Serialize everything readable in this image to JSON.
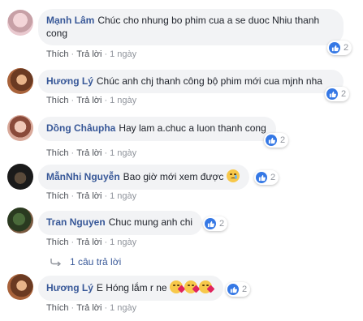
{
  "actions": {
    "like": "Thích",
    "reply": "Trả lời",
    "separator": "·"
  },
  "comments": [
    {
      "author": "Mạnh Lâm",
      "text": "Chúc cho nhung bo phim cua a se duoc Nhiu thanh cong",
      "time": "1 ngày",
      "reactions": "2"
    },
    {
      "author": "Hương Lý",
      "text": "Chúc anh chj thanh công bộ phim mới cua mjnh nha",
      "time": "1 ngày",
      "reactions": "2"
    },
    {
      "author": "Dồng Châupha",
      "text": "Hay lam a.chuc a luon thanh cong",
      "time": "1 ngày",
      "reactions": "2"
    },
    {
      "author": "MẫnNhi Nguyễn",
      "text": "Bao giờ mới xem được",
      "time": "1 ngày",
      "reactions": "2"
    },
    {
      "author": "Tran Nguyen",
      "text": "Chuc mung anh chi",
      "time": "1 ngày",
      "reactions": "2"
    },
    {
      "author": "Hương Lý",
      "text": "E Hóng lắm r ne",
      "time": "1 ngày",
      "reactions": "2"
    }
  ],
  "reply_thread": {
    "label": "1 câu trả lời"
  },
  "colors": {
    "link": "#385898",
    "bubble": "#f2f3f5",
    "like_blue": "#3578e5",
    "meta": "#90949c"
  },
  "icons": [
    "like-icon",
    "sad-emoji-icon",
    "kiss-emoji-icon",
    "reply-arrow-icon"
  ]
}
